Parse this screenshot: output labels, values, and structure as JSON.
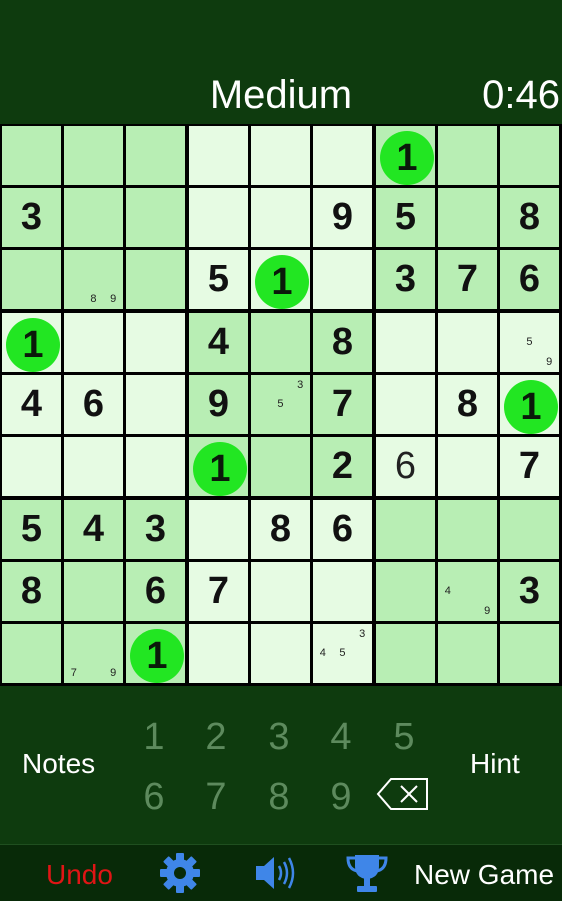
{
  "header": {
    "difficulty": "Medium",
    "timer": "0:46"
  },
  "board": {
    "highlight_digit": "1",
    "rows": [
      [
        {
          "v": "",
          "s": "dark"
        },
        {
          "v": "",
          "s": "dark"
        },
        {
          "v": "",
          "s": "dark"
        },
        {
          "v": "",
          "s": "light"
        },
        {
          "v": "",
          "s": "light"
        },
        {
          "v": "",
          "s": "light"
        },
        {
          "v": "1",
          "s": "dark",
          "hl": true
        },
        {
          "v": "",
          "s": "dark"
        },
        {
          "v": "",
          "s": "dark"
        }
      ],
      [
        {
          "v": "3",
          "s": "dark"
        },
        {
          "v": "",
          "s": "dark"
        },
        {
          "v": "",
          "s": "dark"
        },
        {
          "v": "",
          "s": "light"
        },
        {
          "v": "",
          "s": "light"
        },
        {
          "v": "9",
          "s": "light"
        },
        {
          "v": "5",
          "s": "dark"
        },
        {
          "v": "",
          "s": "dark"
        },
        {
          "v": "8",
          "s": "dark"
        }
      ],
      [
        {
          "v": "",
          "s": "dark"
        },
        {
          "v": "",
          "s": "dark",
          "notes": [
            "",
            "",
            "",
            "",
            "",
            "",
            "",
            "8",
            "9"
          ]
        },
        {
          "v": "",
          "s": "dark"
        },
        {
          "v": "5",
          "s": "light"
        },
        {
          "v": "1",
          "s": "light",
          "hl": true
        },
        {
          "v": "",
          "s": "light"
        },
        {
          "v": "3",
          "s": "dark"
        },
        {
          "v": "7",
          "s": "dark"
        },
        {
          "v": "6",
          "s": "dark"
        }
      ],
      [
        {
          "v": "1",
          "s": "light",
          "hl": true
        },
        {
          "v": "",
          "s": "light"
        },
        {
          "v": "",
          "s": "light"
        },
        {
          "v": "4",
          "s": "dark"
        },
        {
          "v": "",
          "s": "dark"
        },
        {
          "v": "8",
          "s": "dark"
        },
        {
          "v": "",
          "s": "light"
        },
        {
          "v": "",
          "s": "light"
        },
        {
          "v": "",
          "s": "light",
          "notes": [
            "",
            "",
            "",
            "",
            "5",
            "",
            "",
            "",
            "9"
          ]
        }
      ],
      [
        {
          "v": "4",
          "s": "light"
        },
        {
          "v": "6",
          "s": "light"
        },
        {
          "v": "",
          "s": "light"
        },
        {
          "v": "9",
          "s": "dark"
        },
        {
          "v": "",
          "s": "dark",
          "notes": [
            "",
            "",
            "3",
            "",
            "5",
            "",
            "",
            "",
            ""
          ]
        },
        {
          "v": "7",
          "s": "dark"
        },
        {
          "v": "",
          "s": "light"
        },
        {
          "v": "8",
          "s": "light"
        },
        {
          "v": "1",
          "s": "light",
          "hl": true
        }
      ],
      [
        {
          "v": "",
          "s": "light"
        },
        {
          "v": "",
          "s": "light"
        },
        {
          "v": "",
          "s": "light"
        },
        {
          "v": "1",
          "s": "dark",
          "hl": true
        },
        {
          "v": "",
          "s": "dark"
        },
        {
          "v": "2",
          "s": "dark"
        },
        {
          "v": "6",
          "s": "light",
          "user": true
        },
        {
          "v": "",
          "s": "light"
        },
        {
          "v": "7",
          "s": "light"
        }
      ],
      [
        {
          "v": "5",
          "s": "dark"
        },
        {
          "v": "4",
          "s": "dark"
        },
        {
          "v": "3",
          "s": "dark"
        },
        {
          "v": "",
          "s": "light"
        },
        {
          "v": "8",
          "s": "light"
        },
        {
          "v": "6",
          "s": "light"
        },
        {
          "v": "",
          "s": "dark"
        },
        {
          "v": "",
          "s": "dark"
        },
        {
          "v": "",
          "s": "dark"
        }
      ],
      [
        {
          "v": "8",
          "s": "dark"
        },
        {
          "v": "",
          "s": "dark"
        },
        {
          "v": "6",
          "s": "dark"
        },
        {
          "v": "7",
          "s": "light"
        },
        {
          "v": "",
          "s": "light"
        },
        {
          "v": "",
          "s": "light"
        },
        {
          "v": "",
          "s": "dark"
        },
        {
          "v": "",
          "s": "dark",
          "notes": [
            "",
            "",
            "",
            "4",
            "",
            "",
            "",
            "",
            "9"
          ]
        },
        {
          "v": "3",
          "s": "dark"
        }
      ],
      [
        {
          "v": "",
          "s": "dark"
        },
        {
          "v": "",
          "s": "dark",
          "notes": [
            "",
            "",
            "",
            "",
            "",
            "",
            "7",
            "",
            "9"
          ]
        },
        {
          "v": "1",
          "s": "dark",
          "hl": true
        },
        {
          "v": "",
          "s": "light"
        },
        {
          "v": "",
          "s": "light"
        },
        {
          "v": "",
          "s": "light",
          "notes": [
            "",
            "",
            "3",
            "4",
            "5",
            "",
            "",
            "",
            ""
          ]
        },
        {
          "v": "",
          "s": "dark"
        },
        {
          "v": "",
          "s": "dark"
        },
        {
          "v": "",
          "s": "dark"
        }
      ]
    ]
  },
  "controls": {
    "notes_label": "Notes",
    "hint_label": "Hint",
    "numbers": [
      "1",
      "2",
      "3",
      "4",
      "5",
      "6",
      "7",
      "8",
      "9"
    ],
    "erase_icon": "backspace-icon"
  },
  "bottom_bar": {
    "undo_label": "Undo",
    "new_game_label": "New Game",
    "icons": [
      "gear-icon",
      "speaker-icon",
      "trophy-icon"
    ]
  },
  "colors": {
    "background": "#0e3b0e",
    "cell_light": "#e6fbe3",
    "cell_dark": "#b8eeb4",
    "highlight_circle": "#22e622",
    "undo": "#e01515",
    "icon_blue": "#3f86e8",
    "number_dim": "#5d8a5d"
  }
}
